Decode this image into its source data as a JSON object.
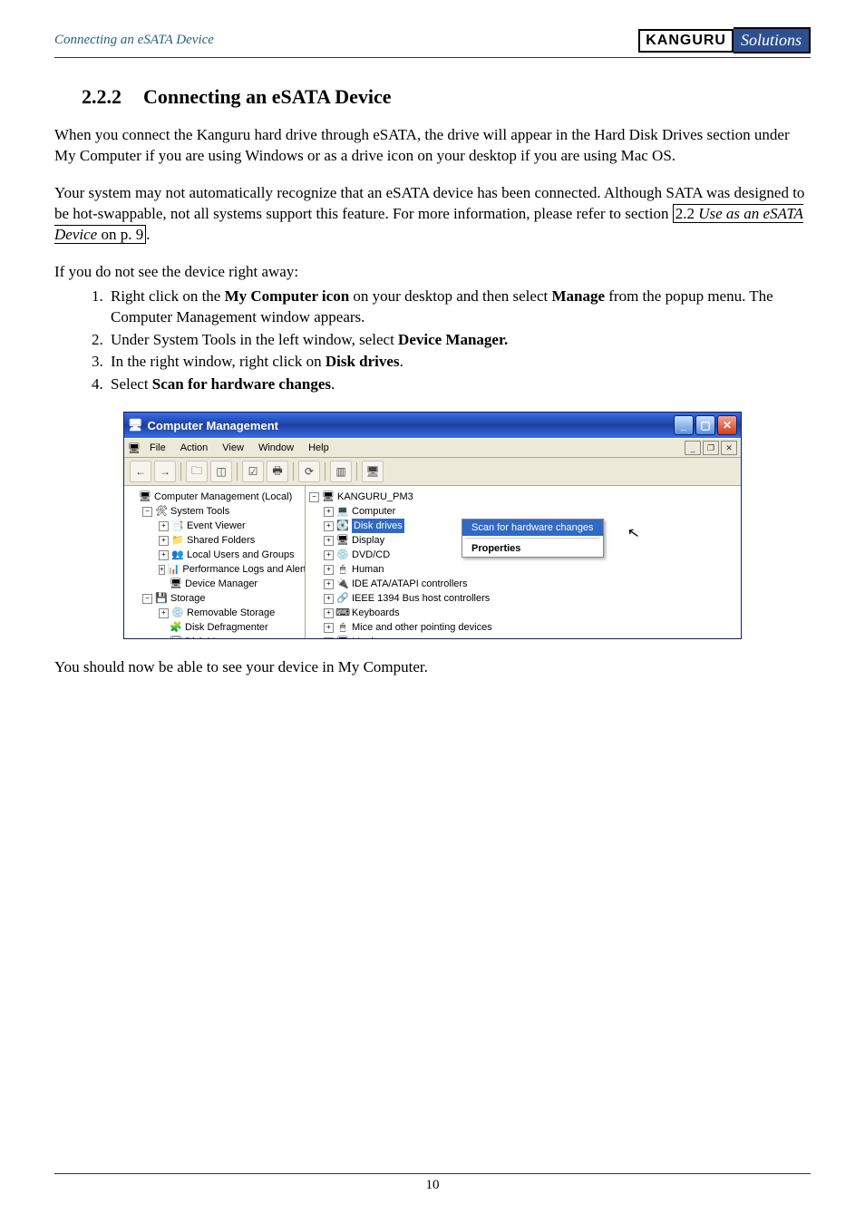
{
  "header": {
    "breadcrumb": "Connecting an eSATA Device",
    "logo_left": "KANGURU",
    "logo_right": "Solutions"
  },
  "section": {
    "number": "2.2.2",
    "title": "Connecting an eSATA Device"
  },
  "paragraphs": {
    "p1": "When you connect the Kanguru hard drive through eSATA, the drive will appear in the Hard Disk Drives section under My Computer if you are using Windows or as a drive icon on your desktop if you are using Mac OS.",
    "p2a": "Your system may not automatically recognize that an eSATA device has been connected. Although SATA was designed to be hot-swappable, not all systems support this feature. For more information, please refer to section ",
    "p2_link_prefix": "2.2 ",
    "p2_link_title": "Use as an eSATA Device",
    "p2_link_suffix": " on p. 9",
    "p2b": ".",
    "p3": "If you do not see the device right away:",
    "p4": "You should now be able to see your device in My Computer."
  },
  "steps": {
    "s1a": "Right click on the ",
    "s1b": "My Computer icon",
    "s1c": " on your desktop and then select ",
    "s1d": "Manage",
    "s1e": " from the popup menu. The Computer Management window appears.",
    "s2a": "Under System Tools in the left window, select ",
    "s2b": "Device Manager.",
    "s3a": "In the right window, right click on ",
    "s3b": "Disk drives",
    "s3c": ".",
    "s4a": "Select ",
    "s4b": "Scan for hardware changes",
    "s4c": "."
  },
  "window": {
    "title": "Computer Management",
    "menus": [
      "File",
      "Action",
      "View",
      "Window",
      "Help"
    ],
    "left_tree": [
      {
        "indent": 0,
        "exp": "",
        "icon": "🖥",
        "label": "Computer Management (Local)"
      },
      {
        "indent": 1,
        "exp": "−",
        "icon": "🛠",
        "label": "System Tools"
      },
      {
        "indent": 2,
        "exp": "+",
        "icon": "📑",
        "label": "Event Viewer"
      },
      {
        "indent": 2,
        "exp": "+",
        "icon": "📁",
        "label": "Shared Folders"
      },
      {
        "indent": 2,
        "exp": "+",
        "icon": "👥",
        "label": "Local Users and Groups"
      },
      {
        "indent": 2,
        "exp": "+",
        "icon": "📊",
        "label": "Performance Logs and Alerts"
      },
      {
        "indent": 2,
        "exp": "",
        "icon": "🖥",
        "label": "Device Manager"
      },
      {
        "indent": 1,
        "exp": "−",
        "icon": "💾",
        "label": "Storage"
      },
      {
        "indent": 2,
        "exp": "+",
        "icon": "💿",
        "label": "Removable Storage"
      },
      {
        "indent": 2,
        "exp": "",
        "icon": "🧩",
        "label": "Disk Defragmenter"
      },
      {
        "indent": 2,
        "exp": "",
        "icon": "🗄",
        "label": "Disk Management"
      }
    ],
    "right_tree": [
      {
        "indent": 0,
        "exp": "−",
        "icon": "🖥",
        "label": "KANGURU_PM3"
      },
      {
        "indent": 1,
        "exp": "+",
        "icon": "💻",
        "label": "Computer"
      },
      {
        "indent": 1,
        "exp": "+",
        "icon": "💽",
        "label": "Disk drives",
        "hl": true
      },
      {
        "indent": 1,
        "exp": "+",
        "icon": "🖥",
        "label": "Display"
      },
      {
        "indent": 1,
        "exp": "+",
        "icon": "💿",
        "label": "DVD/CD"
      },
      {
        "indent": 1,
        "exp": "+",
        "icon": "🖱",
        "label": "Human"
      },
      {
        "indent": 1,
        "exp": "+",
        "icon": "🔌",
        "label": "IDE ATA/ATAPI controllers"
      },
      {
        "indent": 1,
        "exp": "+",
        "icon": "🔗",
        "label": "IEEE 1394 Bus host controllers"
      },
      {
        "indent": 1,
        "exp": "+",
        "icon": "⌨",
        "label": "Keyboards"
      },
      {
        "indent": 1,
        "exp": "+",
        "icon": "🖱",
        "label": "Mice and other pointing devices"
      },
      {
        "indent": 1,
        "exp": "+",
        "icon": "🖥",
        "label": "Monitors"
      }
    ],
    "context_menu": {
      "scan": "Scan for hardware changes",
      "properties": "Properties"
    }
  },
  "footer": {
    "page_number": "10"
  }
}
